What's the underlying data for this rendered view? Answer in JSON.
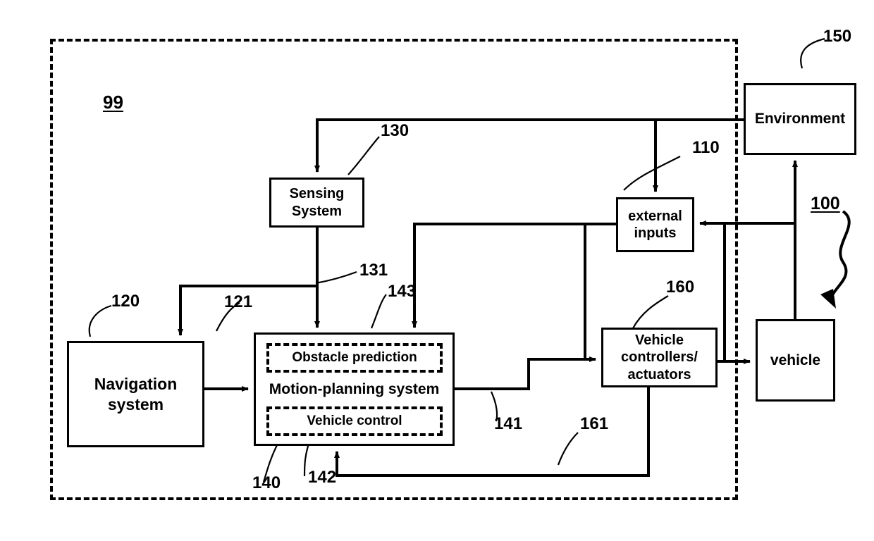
{
  "figure": {
    "type": "patent-block-diagram",
    "outer_boundary_label": "99",
    "outer_boundary_style": "dashed"
  },
  "blocks": {
    "environment": {
      "label": "Environment",
      "ref": "150"
    },
    "external_inputs": {
      "label": "external\ninputs",
      "ref": "110"
    },
    "sensing_system": {
      "label": "Sensing\nSystem",
      "ref": "130"
    },
    "navigation_system": {
      "label": "Navigation\nsystem",
      "ref": "120"
    },
    "motion_planning_system": {
      "label": "Motion-planning system",
      "ref": "140",
      "sub_blocks": [
        {
          "label": "Obstacle prediction",
          "ref": "143"
        },
        {
          "label": "Vehicle control",
          "ref": "142"
        }
      ]
    },
    "vehicle_controllers": {
      "label": "Vehicle\ncontrollers/\nactuators",
      "ref": "160"
    },
    "vehicle": {
      "label": "vehicle",
      "ref": "100"
    }
  },
  "connector_refs": {
    "env_to_sensing": "130",
    "env_to_external": "110",
    "sensing_out": "131",
    "nav_to_planning": "121",
    "external_to_planning": "143",
    "planning_to_controllers": "141",
    "controllers_feedback": "161",
    "system_boundary": "99",
    "vehicle_callout": "100",
    "environment_callout": "150",
    "nav_callout": "120",
    "planning_callout": "140",
    "vehicle_control_callout": "142",
    "controllers_callout": "160"
  },
  "colors": {
    "stroke": "#000000",
    "background": "#ffffff"
  }
}
